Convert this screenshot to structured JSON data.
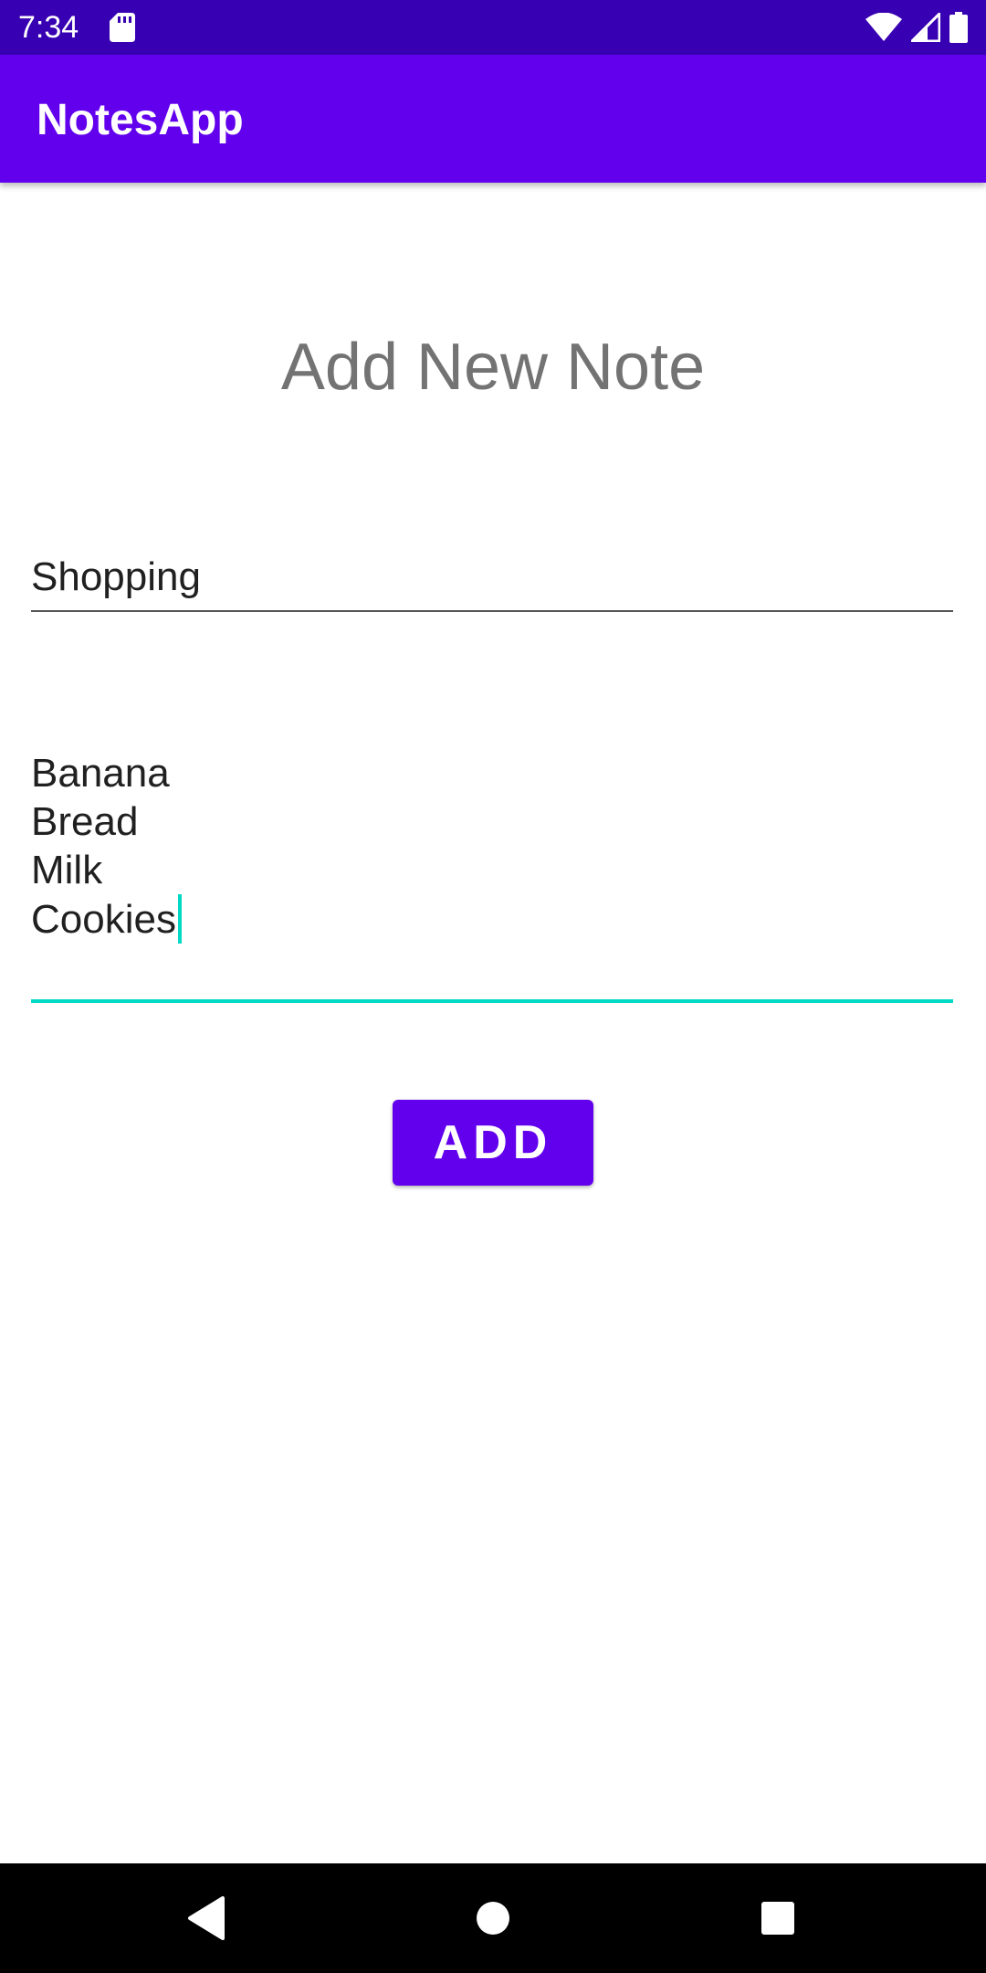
{
  "status_bar": {
    "time": "7:34",
    "icons": [
      "sd-card-icon",
      "wifi-icon",
      "signal-icon",
      "battery-icon"
    ]
  },
  "app_bar": {
    "title": "NotesApp"
  },
  "page": {
    "heading": "Add New Note"
  },
  "form": {
    "title_field": {
      "value": "Shopping"
    },
    "content_field": {
      "lines": [
        "Banana",
        "Bread",
        "Milk",
        "Cookies"
      ]
    },
    "add_button_label": "ADD"
  },
  "nav_bar": {
    "buttons": [
      "back-icon",
      "home-icon",
      "recents-icon"
    ]
  },
  "colors": {
    "status_bar": "#3700B3",
    "primary": "#6200EE",
    "accent": "#03DAC5",
    "heading_text": "#737373"
  }
}
